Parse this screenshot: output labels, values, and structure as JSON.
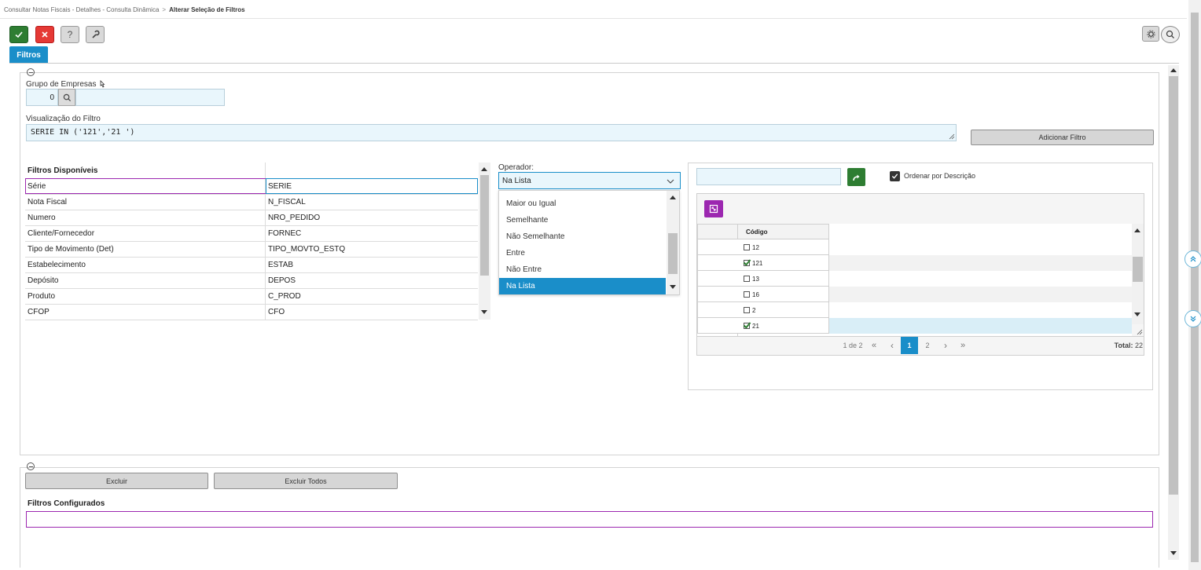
{
  "breadcrumb": {
    "item1": "Consultar Notas Fiscais - Detalhes - Consulta Dinâmica",
    "separator": ">",
    "current": "Alterar Seleção de Filtros"
  },
  "colors": {
    "accent": "#1a8ec9",
    "confirm": "#2e7d32",
    "cancel": "#e53935",
    "purple": "#9c27b0",
    "input_bg": "#e9f6fc"
  },
  "tabs": [
    {
      "label": "Filtros",
      "active": true
    }
  ],
  "grupo_empresas": {
    "label": "Grupo de Empresas",
    "value": "0",
    "description": ""
  },
  "visualizacao": {
    "label": "Visualização do Filtro",
    "value": "SERIE IN ('121','21 ')"
  },
  "buttons": {
    "adicionar_filtro": "Adicionar Filtro",
    "excluir": "Excluir",
    "excluir_todos": "Excluir Todos"
  },
  "filtros_disponiveis": {
    "header": "Filtros Disponíveis",
    "rows": [
      {
        "label": "Série",
        "field": "SERIE",
        "selected": true
      },
      {
        "label": "Nota Fiscal",
        "field": "N_FISCAL"
      },
      {
        "label": "Numero",
        "field": "NRO_PEDIDO"
      },
      {
        "label": "Cliente/Fornecedor",
        "field": "FORNEC"
      },
      {
        "label": "Tipo de Movimento (Det)",
        "field": "TIPO_MOVTO_ESTQ"
      },
      {
        "label": "Estabelecimento",
        "field": "ESTAB"
      },
      {
        "label": "Depósito",
        "field": "DEPOS"
      },
      {
        "label": "Produto",
        "field": "C_PROD"
      },
      {
        "label": "CFOP",
        "field": "CFO"
      }
    ]
  },
  "operador": {
    "label": "Operador:",
    "selected": "Na Lista",
    "options": [
      {
        "label": "Maior ou Igual"
      },
      {
        "label": "Semelhante"
      },
      {
        "label": "Não Semelhante"
      },
      {
        "label": "Entre"
      },
      {
        "label": "Não Entre"
      },
      {
        "label": "Na Lista",
        "selected": true
      }
    ]
  },
  "valores": {
    "search_value": "",
    "ordenar_label": "Ordenar por Descrição",
    "ordenar_checked": true,
    "column_header": "Código",
    "rows": [
      {
        "code": "12",
        "checked": false
      },
      {
        "code": "121",
        "checked": true
      },
      {
        "code": "13",
        "checked": false
      },
      {
        "code": "16",
        "checked": false
      },
      {
        "code": "2",
        "checked": false
      },
      {
        "code": "21",
        "checked": true
      }
    ],
    "pager": {
      "page_info": "1 de 2",
      "first": "«",
      "prev": "‹",
      "page1": "1",
      "page2": "2",
      "next": "›",
      "last": "»",
      "total_label": "Total:",
      "total": "22",
      "current_page": 1
    }
  },
  "filtros_configurados": {
    "header": "Filtros Configurados"
  }
}
